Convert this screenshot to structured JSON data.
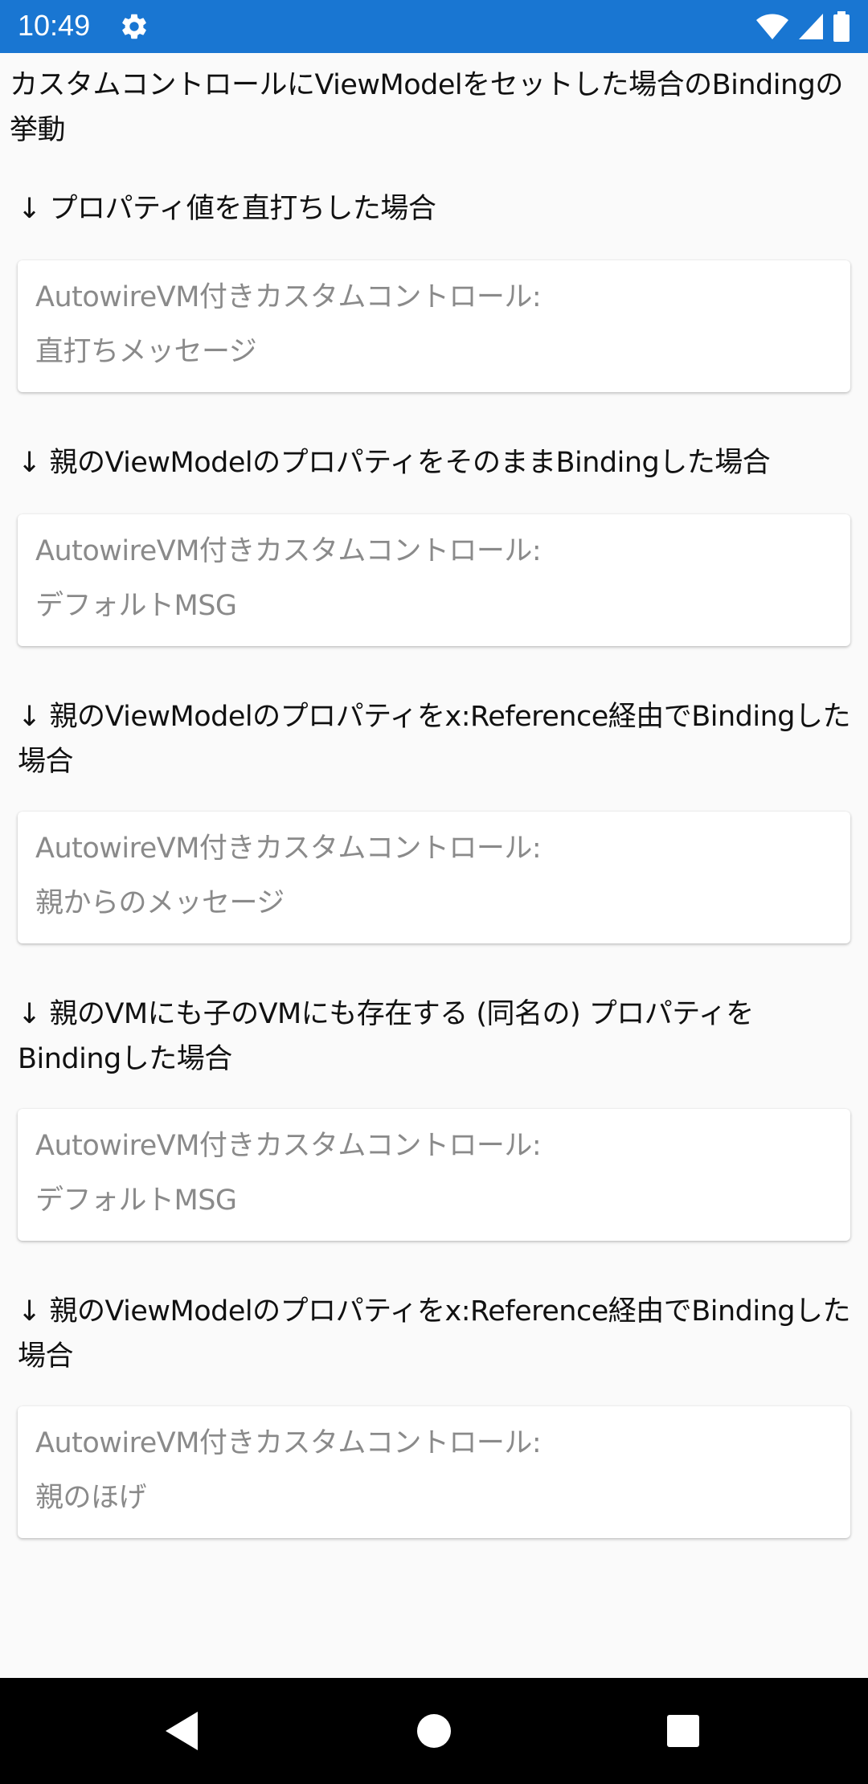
{
  "status_bar": {
    "time": "10:49",
    "color": "#1976d2",
    "icons": [
      "settings-icon",
      "wifi-icon",
      "signal-icon",
      "battery-icon"
    ]
  },
  "page": {
    "title": "カスタムコントロールにViewModelをセットした場合のBindingの挙動"
  },
  "sections": [
    {
      "label": "↓ プロパティ値を直打ちした場合",
      "card_title": "AutowireVM付きカスタムコントロール:",
      "card_value": "直打ちメッセージ"
    },
    {
      "label": "↓ 親のViewModelのプロパティをそのままBindingした場合",
      "card_title": "AutowireVM付きカスタムコントロール:",
      "card_value": "デフォルトMSG"
    },
    {
      "label": "↓ 親のViewModelのプロパティをx:Reference経由でBindingした場合",
      "card_title": "AutowireVM付きカスタムコントロール:",
      "card_value": "親からのメッセージ"
    },
    {
      "label": "↓ 親のVMにも子のVMにも存在する (同名の) プロパティをBindingした場合",
      "card_title": "AutowireVM付きカスタムコントロール:",
      "card_value": "デフォルトMSG"
    },
    {
      "label": "↓ 親のViewModelのプロパティをx:Reference経由でBindingした場合",
      "card_title": "AutowireVM付きカスタムコントロール:",
      "card_value": "親のほげ"
    }
  ],
  "nav_bar": {
    "buttons": [
      "back-icon",
      "home-icon",
      "recents-icon"
    ]
  }
}
